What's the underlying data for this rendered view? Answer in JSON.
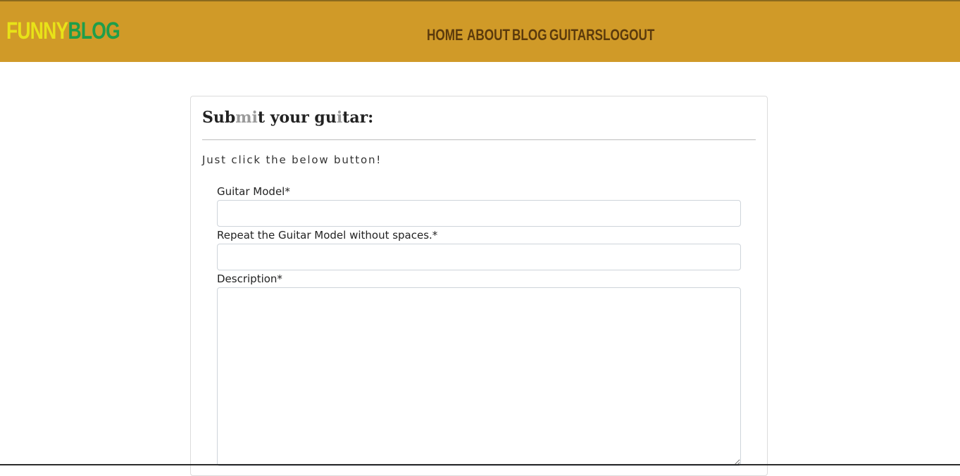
{
  "header": {
    "brand_part1": "FUNNY",
    "brand_part2": "BLOG",
    "nav": {
      "home": "Home",
      "about": "About",
      "blog": "Blog",
      "guitars": "Guitars",
      "logout": "Logout"
    }
  },
  "card": {
    "title_parts": [
      "Sub",
      "mi",
      "t your gu",
      "i",
      "tar:"
    ],
    "lead": "Just click the below button!",
    "fields": {
      "model_label": "Guitar Model*",
      "model_value": "",
      "slug_label": "Repeat the Guitar Model without spaces.*",
      "slug_value": "",
      "description_label": "Description*",
      "description_value": ""
    }
  },
  "colors": {
    "navbar_bg": "#d09a28",
    "brand_funny": "#e8e218",
    "brand_blog": "#1f9e4a",
    "nav_text": "#5b3a0c"
  }
}
